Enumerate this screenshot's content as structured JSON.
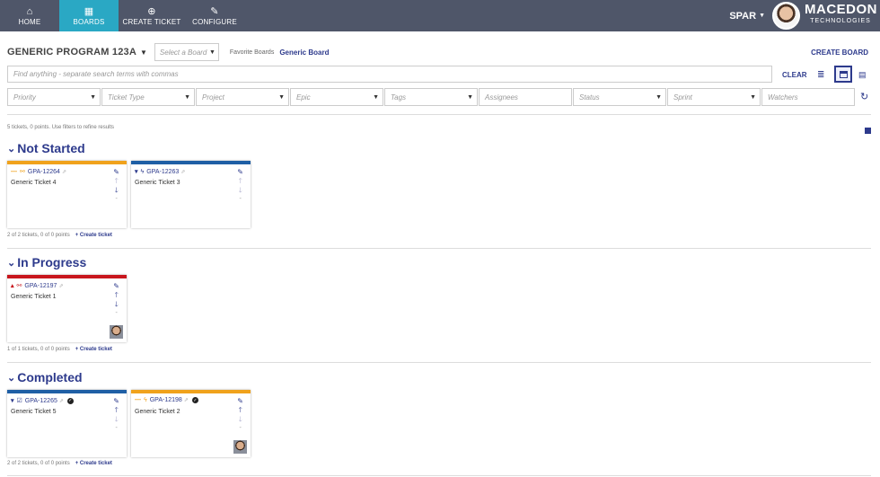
{
  "nav": {
    "items": [
      {
        "icon": "home-icon",
        "label": "HOME"
      },
      {
        "icon": "boards-icon",
        "label": "BOARDS"
      },
      {
        "icon": "plus-circle-icon",
        "label": "CREATE TICKET"
      },
      {
        "icon": "wrench-icon",
        "label": "CONFIGURE"
      }
    ],
    "active": "BOARDS",
    "user": "SPAR",
    "brand_name": "MACEDON",
    "brand_sub": "TECHNOLOGIES"
  },
  "toolbar": {
    "program": "GENERIC PROGRAM 123A",
    "board_placeholder": "Select a Board",
    "favorites_label": "Favorite Boards",
    "favorite_board": "Generic Board",
    "create_board": "CREATE BOARD",
    "search_placeholder": "Find anything - separate search terms with commas",
    "clear": "CLEAR"
  },
  "filters": [
    "Priority",
    "Ticket Type",
    "Project",
    "Epic",
    "Tags",
    "Assignees",
    "Status",
    "Sprint",
    "Watchers"
  ],
  "summary": "5 tickets, 0 points. Use filters to refine results",
  "colors": {
    "accent": "#2d3a8c",
    "nav_bg": "#4f5669",
    "nav_active": "#2aa8c4",
    "orange": "#f0a21c",
    "blue": "#1f5fa5",
    "red": "#c8161d"
  },
  "sections": [
    {
      "title": "Not Started",
      "footer": "2 of 2 tickets, 0 of 0 points",
      "create": "+ Create ticket",
      "cards": [
        {
          "key": "GPA-12264",
          "title": "Generic Ticket 4",
          "bar": "#f0a21c",
          "priority": "—",
          "priority_color": "#f0a21c",
          "type_icon": "epic-icon",
          "type_glyph": "⚯",
          "type_color": "#f0a21c",
          "done": false,
          "avatar": false
        },
        {
          "key": "GPA-12263",
          "title": "Generic Ticket 3",
          "bar": "#1f5fa5",
          "priority": "▾",
          "priority_color": "#2d3a8c",
          "type_icon": "bolt-icon",
          "type_glyph": "ϟ",
          "type_color": "#2d3a8c",
          "done": false,
          "avatar": false
        }
      ]
    },
    {
      "title": "In Progress",
      "footer": "1 of 1 tickets, 0 of 0 points",
      "create": "+ Create ticket",
      "cards": [
        {
          "key": "GPA-12197",
          "title": "Generic Ticket 1",
          "bar": "#c8161d",
          "priority": "▴",
          "priority_color": "#c8161d",
          "type_icon": "epic-icon",
          "type_glyph": "⚯",
          "type_color": "#c8161d",
          "done": false,
          "avatar": true
        }
      ]
    },
    {
      "title": "Completed",
      "footer": "2 of 2 tickets, 0 of 0 points",
      "create": "+ Create ticket",
      "cards": [
        {
          "key": "GPA-12265",
          "title": "Generic Ticket 5",
          "bar": "#1f5fa5",
          "priority": "▾",
          "priority_color": "#2d3a8c",
          "type_icon": "checkbox-icon",
          "type_glyph": "☑",
          "type_color": "#2d3a8c",
          "done": true,
          "avatar": false
        },
        {
          "key": "GPA-12198",
          "title": "Generic Ticket 2",
          "bar": "#f0a21c",
          "priority": "—",
          "priority_color": "#f0a21c",
          "type_icon": "bolt-icon",
          "type_glyph": "ϟ",
          "type_color": "#f0a21c",
          "done": true,
          "avatar": true
        }
      ]
    }
  ]
}
